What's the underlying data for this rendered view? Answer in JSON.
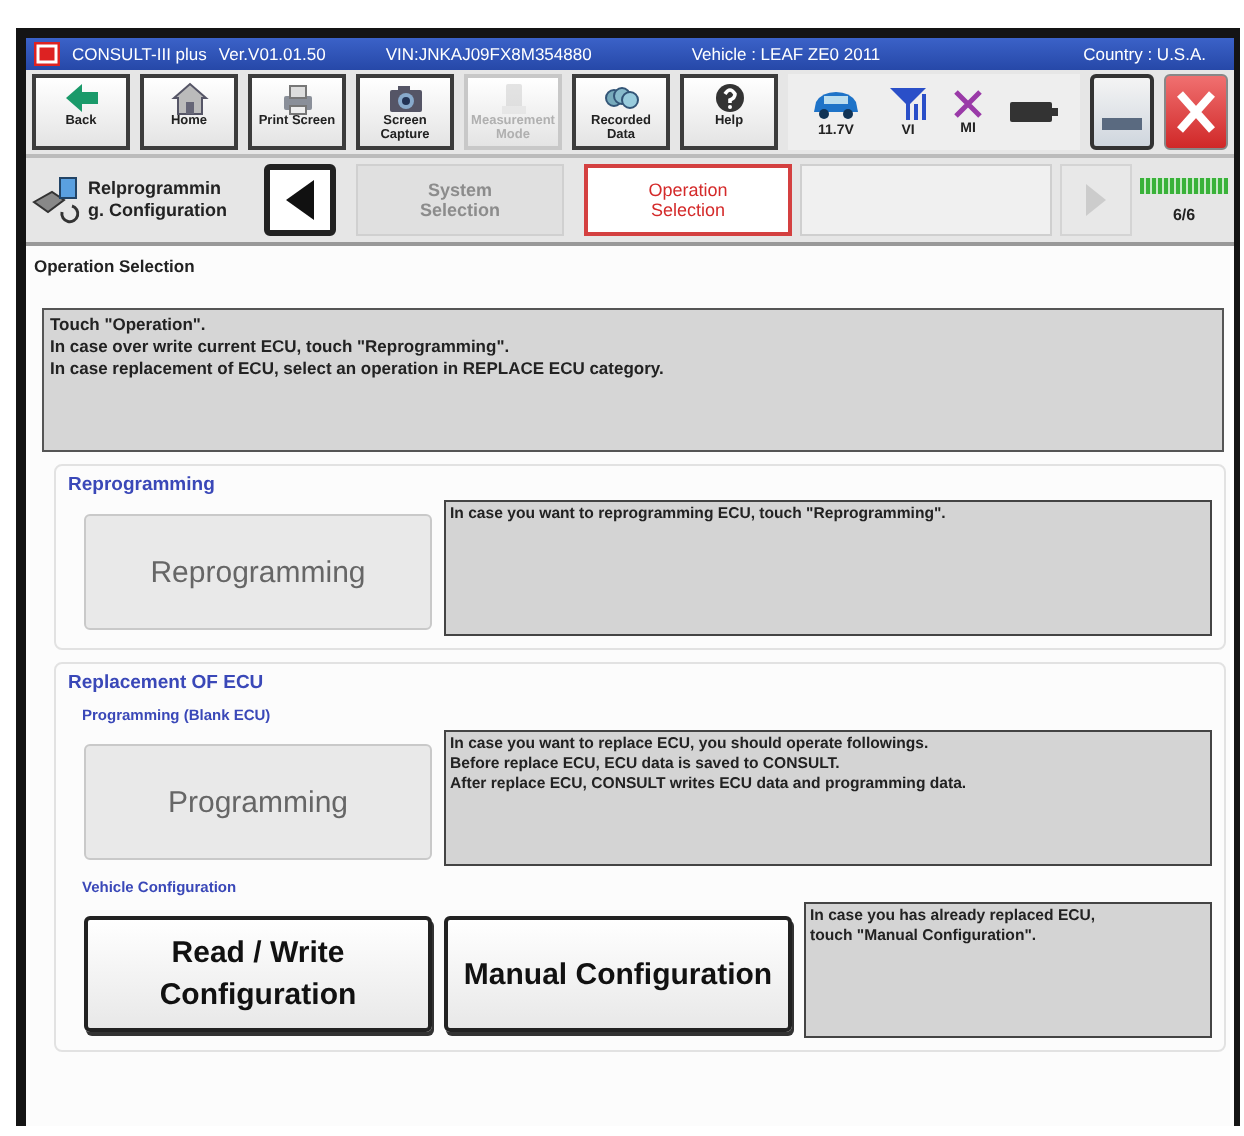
{
  "title_bar": {
    "app": "CONSULT-III plus",
    "version": "Ver.V01.01.50",
    "vin": "VIN:JNKAJ09FX8M354880",
    "vehicle": "Vehicle : LEAF ZE0 2011",
    "country": "Country : U.S.A."
  },
  "toolbar": [
    {
      "label": "Back",
      "kind": "back",
      "disabled": false
    },
    {
      "label": "Home",
      "kind": "home",
      "disabled": false
    },
    {
      "label": "Print Screen",
      "kind": "print",
      "disabled": false
    },
    {
      "label": "Screen Capture",
      "kind": "camera",
      "disabled": false
    },
    {
      "label": "Measurement Mode",
      "kind": "meter",
      "disabled": true
    },
    {
      "label": "Recorded Data",
      "kind": "data",
      "disabled": false
    },
    {
      "label": "Help",
      "kind": "help",
      "disabled": false
    }
  ],
  "status": [
    {
      "label": "11.7V",
      "kind": "car"
    },
    {
      "label": "VI",
      "kind": "signal"
    },
    {
      "label": "MI",
      "kind": "cross"
    },
    {
      "kind": "battery"
    }
  ],
  "breadcrumb": {
    "function_lines": [
      "Relprogrammin",
      "g. Configuration"
    ],
    "steps": [
      {
        "label": "System Selection",
        "selected": false
      },
      {
        "label": "Operation Selection",
        "selected": true
      }
    ],
    "progress": {
      "level": 1,
      "reading": "6/6"
    }
  },
  "screen_title": "Operation Selection",
  "instructions": "Touch \"Operation\".\nIn case over write current ECU, touch \"Reprogramming\".\nIn case replacement of ECU, select an operation in REPLACE ECU category.",
  "sections": [
    {
      "title": "Reprogramming",
      "groups": [
        {
          "buttons": [
            {
              "label": "Reprogramming",
              "disabled": true
            }
          ],
          "description": "In case you want to reprogramming ECU, touch \"Reprogramming\"."
        }
      ]
    },
    {
      "title": "Replacement OF ECU",
      "groups": [
        {
          "subtitle": "Programming (Blank ECU)",
          "buttons": [
            {
              "label": "Programming",
              "disabled": true
            }
          ],
          "description": "In case you want to replace ECU, you should operate followings.\nBefore replace ECU, ECU data is saved to CONSULT.\nAfter replace ECU, CONSULT writes ECU data and programming data."
        },
        {
          "subtitle": "Vehicle Configuration",
          "buttons": [
            {
              "label": "Read / Write Configuration",
              "disabled": false
            },
            {
              "label": "Manual Configuration",
              "disabled": false
            }
          ],
          "description": "In case you has already replaced ECU,\ntouch \"Manual Configuration\"."
        }
      ]
    }
  ]
}
